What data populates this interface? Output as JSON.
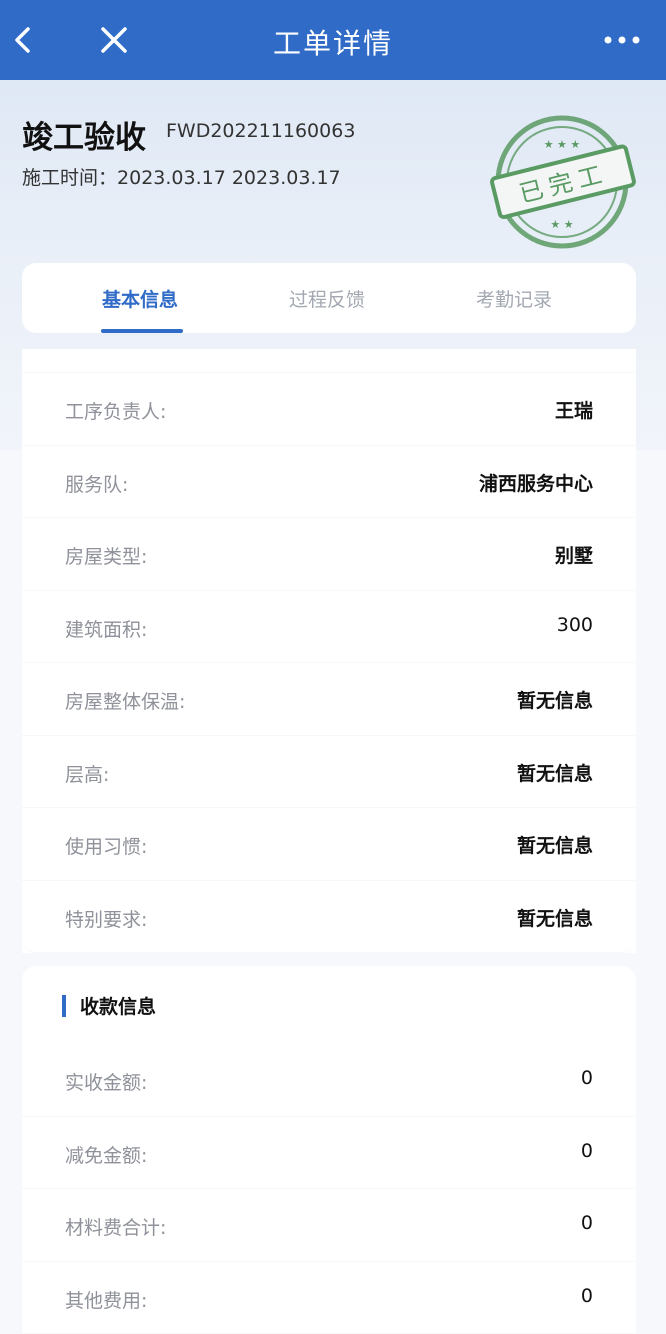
{
  "header": {
    "title": "工单详情",
    "icons": {
      "back": "chevron-left-icon",
      "close": "close-icon",
      "more": "more-dots-icon"
    }
  },
  "order": {
    "name": "竣工验收",
    "code": "FWD202211160063",
    "time_label": "施工时间：",
    "time_value": "2023.03.17 2023.03.17",
    "stamp_text": "已完工"
  },
  "tabs": [
    {
      "label": "基本信息",
      "active": true
    },
    {
      "label": "过程反馈",
      "active": false
    },
    {
      "label": "考勤记录",
      "active": false
    }
  ],
  "basic_info": [
    {
      "label": "工序负责人:",
      "value": "王瑞"
    },
    {
      "label": "服务队:",
      "value": "浦西服务中心"
    },
    {
      "label": "房屋类型:",
      "value": "别墅"
    },
    {
      "label": "建筑面积:",
      "value": "300"
    },
    {
      "label": "房屋整体保温:",
      "value": "暂无信息"
    },
    {
      "label": "层高:",
      "value": "暂无信息"
    },
    {
      "label": "使用习惯:",
      "value": "暂无信息"
    },
    {
      "label": "特别要求:",
      "value": "暂无信息"
    }
  ],
  "payment": {
    "title": "收款信息",
    "rows": [
      {
        "label": "实收金额:",
        "value": "0"
      },
      {
        "label": "减免金额:",
        "value": "0"
      },
      {
        "label": "材料费合计:",
        "value": "0"
      },
      {
        "label": "其他费用:",
        "value": "0"
      }
    ]
  },
  "colors": {
    "primary": "#2f6bc7",
    "stamp": "#5a9a63"
  }
}
